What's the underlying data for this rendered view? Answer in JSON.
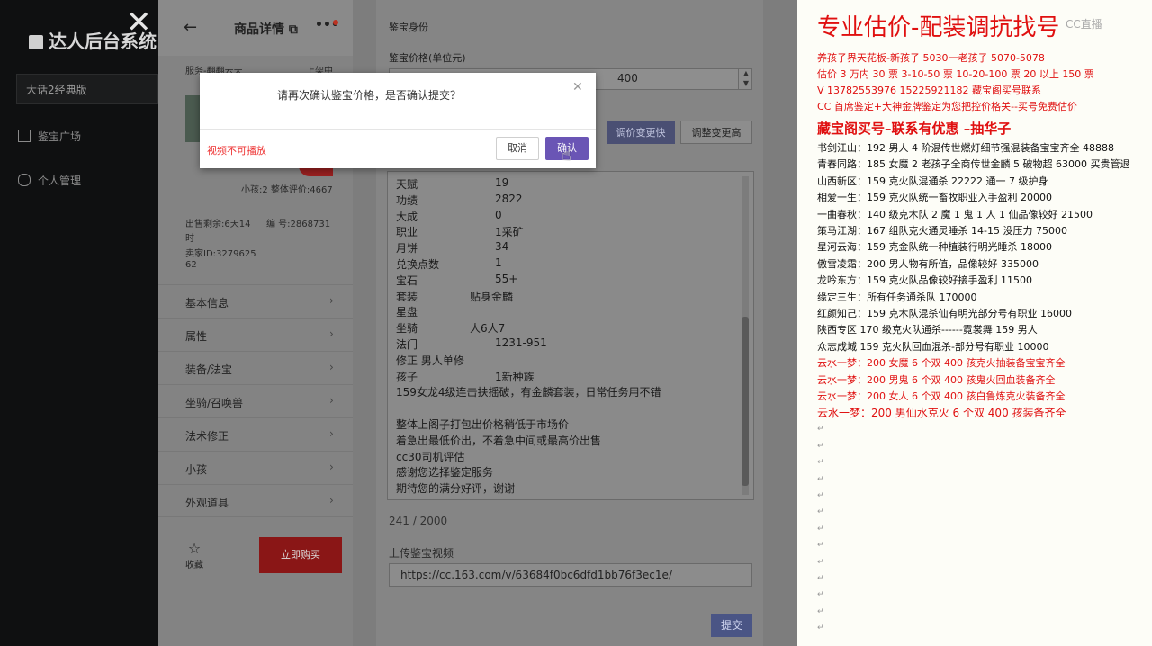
{
  "app": {
    "title": "达人后台系统",
    "search_value": "大话2经典版",
    "nav": [
      "鉴宝广场",
      "个人管理"
    ]
  },
  "detail": {
    "title": "商品详情",
    "server": "服务-翻翻云天",
    "status": "上架中",
    "seller_rating": "小孩:2  整体评价:4667",
    "listing_time": "出售剩余:6天14",
    "listing_time_unit": "时",
    "order_label": "编 号:2868731",
    "seller_id_line1": "卖家ID:3279625",
    "seller_id_line2": "62",
    "menu": [
      "基本信息",
      "属性",
      "装备/法宝",
      "坐骑/召唤兽",
      "法术修正",
      "小孩",
      "外观道具"
    ],
    "fav_label": "收藏",
    "buy_label": "立即购买"
  },
  "form": {
    "section_hint": "鉴宝身份",
    "price_label": "鉴宝价格(单位元)",
    "price_value": "400",
    "btn_adjust_fast": "调价变更快",
    "btn_adjust_high": "调整变更高",
    "char_count": "241 / 2000",
    "video_label": "上传鉴宝视频",
    "video_url": "https://cc.163.com/v/63684f0bc6dfd1bb76f3ec1e/",
    "submit": "提交",
    "desc_rows": [
      {
        "k": "天赋",
        "v": "19"
      },
      {
        "k": "功绩",
        "v": "2822"
      },
      {
        "k": "大成",
        "v": "0"
      },
      {
        "k": "职业",
        "v": "1采矿"
      },
      {
        "k": "月饼",
        "v": "34"
      },
      {
        "k": "兑换点数",
        "v": "1"
      },
      {
        "k": "宝石",
        "v": "55+"
      },
      {
        "k": "套装",
        "v": "贴身金麟"
      },
      {
        "k": "星盘",
        "v": ""
      },
      {
        "k": "坐骑",
        "v": "人6人7"
      },
      {
        "k": "法门",
        "v": "1231-951"
      }
    ],
    "desc_lines": [
      "修正 男人单修",
      "孩子",
      "159女龙4级连击扶摇破，有金麟套装，日常任务用不错",
      "",
      "整体上阁子打包出价格稍低于市场价",
      "着急出最低价出，不着急中间或最高价出售",
      "cc30司机评估",
      "感谢您选择鉴定服务",
      "期待您的满分好评，谢谢"
    ],
    "child_value": "1新种族"
  },
  "modal": {
    "message": "请再次确认鉴宝价格，是否确认提交？",
    "warning": "视频不可播放",
    "cancel": "取消",
    "confirm": "确认"
  },
  "doc": {
    "title": "专业估价-配装调抗找号",
    "watermark": "CC直播",
    "lines_red": [
      "养孩子界天花板-新孩子 5030一老孩子 5070-5078",
      "估价 3 万内 30 票   3-10-50 票   10-20-100 票   20 以上 150 票",
      "V 13782553976    15225921182   藏宝阁买号联系",
      "CC 首席鉴定+大神金牌鉴定为您把控价格关--买号免费估价"
    ],
    "highlight": "藏宝阁买号–联系有优惠 –抽华子",
    "lines_black": [
      "书剑江山：192 男人 4 阶混传世燃灯细节强混装备宝宝齐全 48888",
      "青春同路：185 女魔 2 老孩子全商传世金麟 5 破物超 63000 买贵管退",
      "山西新区：159 克火队混通杀 22222 通一 7 级护身",
      "相爱一生：159 克火队统一畜牧职业入手盈利 20000",
      "一曲春秋：140 级克木队 2 魔 1 鬼 1 人 1 仙品像较好 21500",
      "策马江湖：167 组队克火通灵睡杀 14-15 没压力 75000",
      "星河云海：159 克金队统一种植装行明光睡杀 18000",
      "傲雪凌霜：200 男人物有所值，品像较好 335000",
      "龙吟东方：159 克火队品像较好接手盈利 11500",
      "缘定三生：所有任务通杀队 170000",
      "红颜知己：159 克木队混杀仙有明光部分号有职业 16000",
      "陕西专区 170 级克火队通杀------霓裳舞 159 男人",
      "众志成城 159 克火队回血混杀-部分号有职业 10000"
    ],
    "lines_red2": [
      "云水一梦：200 女魔 6 个双 400 孩克火抽装备宝宝齐全",
      "云水一梦：200 男鬼 6 个双 400 孩鬼火回血装备齐全",
      "云水一梦：200 女人 6 个双 400 孩白鲁炼克火装备齐全"
    ],
    "last_line": "云水一梦：200 男仙水克火 6 个双 400 孩装备齐全"
  }
}
